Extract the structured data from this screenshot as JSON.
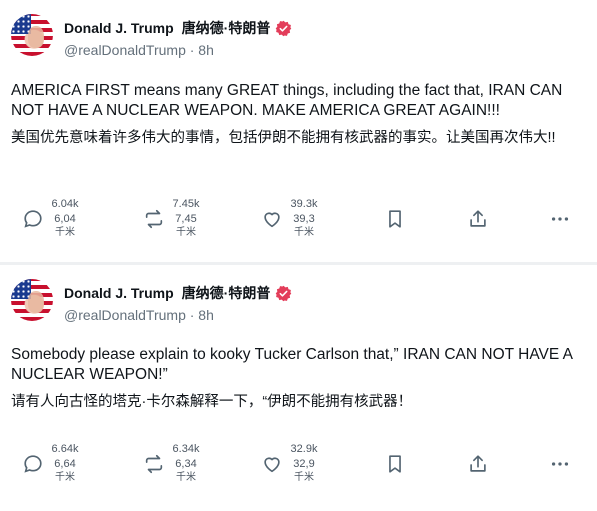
{
  "posts": [
    {
      "display_name": "Donald J. Trump",
      "alt_name": "唐纳德·特朗普",
      "handle": "@realDonaldTrump",
      "time": "· 8h",
      "text_en": "AMERICA FIRST means many GREAT things, including the fact that, IRAN CAN NOT HAVE A NUCLEAR WEAPON. MAKE AMERICA GREAT AGAIN!!!",
      "text_zh": "美国优先意味着许多伟大的事情，包括伊朗不能拥有核武器的事实。让美国再次伟大!!",
      "stats": {
        "replies": [
          "6.04k",
          "6,04",
          "千米"
        ],
        "retruths": [
          "7.45k",
          "7,45",
          "千米"
        ],
        "likes": [
          "39.3k",
          "39,3",
          "千米"
        ]
      }
    },
    {
      "display_name": "Donald J. Trump",
      "alt_name": "唐纳德·特朗普",
      "handle": "@realDonaldTrump",
      "time": "· 8h",
      "text_en": "Somebody please explain to kooky Tucker Carlson that,” IRAN CAN NOT HAVE A NUCLEAR WEAPON!”",
      "text_zh": "请有人向古怪的塔克·卡尔森解释一下，“伊朗不能拥有核武器！",
      "stats": {
        "replies": [
          "6.64k",
          "6,64",
          "千米"
        ],
        "retruths": [
          "6.34k",
          "6,34",
          "千米"
        ],
        "likes": [
          "32.9k",
          "32,9",
          "千米"
        ]
      }
    }
  ],
  "colors": {
    "verified": "#e33d5a",
    "icon": "#536471",
    "divider": "#eef0f2"
  },
  "icons": [
    "reply-icon",
    "retruth-icon",
    "like-icon",
    "bookmark-icon",
    "share-icon",
    "more-icon",
    "verified-badge-icon"
  ]
}
